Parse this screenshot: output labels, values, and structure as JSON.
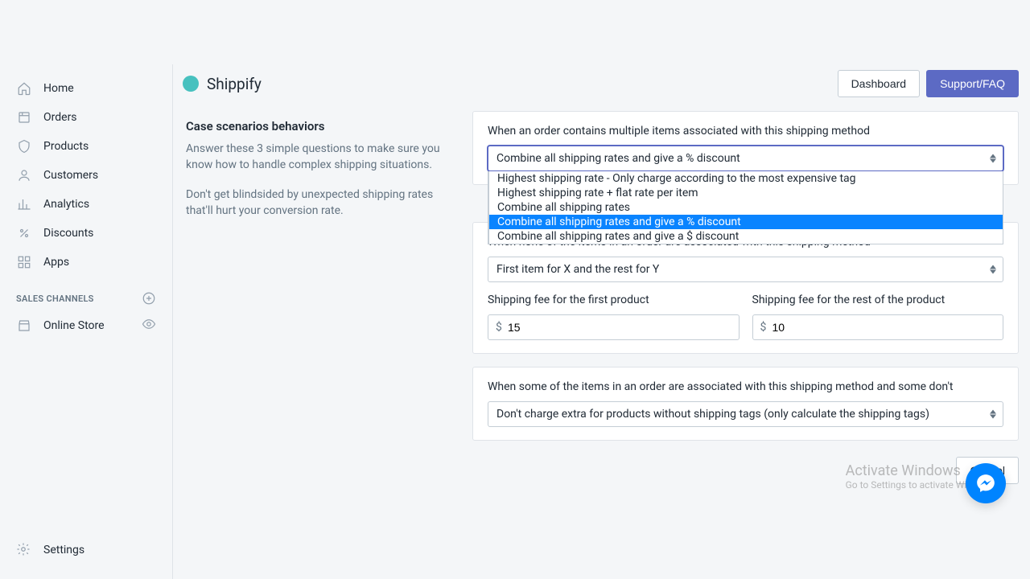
{
  "brand": {
    "name": "Shippify"
  },
  "topbar": {
    "dashboard": "Dashboard",
    "support": "Support/FAQ"
  },
  "sidebar": {
    "items": [
      {
        "label": "Home"
      },
      {
        "label": "Orders"
      },
      {
        "label": "Products"
      },
      {
        "label": "Customers"
      },
      {
        "label": "Analytics"
      },
      {
        "label": "Discounts"
      },
      {
        "label": "Apps"
      }
    ],
    "section": "SALES CHANNELS",
    "channels": [
      {
        "label": "Online Store"
      }
    ],
    "settings": "Settings"
  },
  "left": {
    "heading": "Case scenarios behaviors",
    "p1": "Answer these 3 simple questions to make sure you know how to handle complex shipping situations.",
    "p2": "Don't get blindsided by unexpected shipping rates that'll hurt your conversion rate."
  },
  "q1": {
    "label": "When an order contains multiple items associated with this shipping method",
    "selected": "Combine all shipping rates and give a % discount",
    "options": [
      "Highest shipping rate - Only charge according to the most expensive tag",
      "Highest shipping rate + flat rate per item",
      "Combine all shipping rates",
      "Combine all shipping rates and give a % discount",
      "Combine all shipping rates and give a $ discount"
    ]
  },
  "q2": {
    "label": "When none of the items in an order are associated with this shipping method",
    "selected": "First item for X and the rest for Y",
    "fee_first_label": "Shipping fee for the first product",
    "fee_rest_label": "Shipping fee for the rest of the product",
    "currency": "$",
    "fee_first": "15",
    "fee_rest": "10"
  },
  "q3": {
    "label": "When some of the items in an order are associated with this shipping method and some don't",
    "selected": "Don't charge extra for products without shipping tags (only calculate the shipping tags)"
  },
  "actions": {
    "cancel": "Cancel"
  },
  "watermark": {
    "line1": "Activate Windows",
    "line2": "Go to Settings to activate Windows."
  }
}
